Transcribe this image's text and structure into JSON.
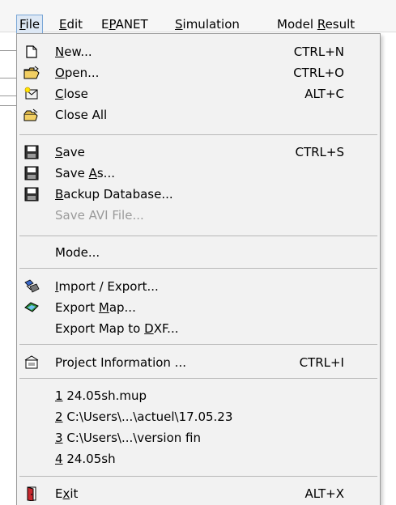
{
  "menubar": {
    "items": [
      {
        "pre": "",
        "u": "F",
        "post": "ile"
      },
      {
        "pre": "",
        "u": "E",
        "post": "dit"
      },
      {
        "pre": "E",
        "u": "P",
        "post": "ANET"
      },
      {
        "pre": "",
        "u": "S",
        "post": "imulation"
      },
      {
        "pre": "Model ",
        "u": "R",
        "post": "esult"
      }
    ]
  },
  "file_menu": {
    "items": [
      {
        "pre": "",
        "u": "N",
        "post": "ew...",
        "shortcut": "CTRL+N",
        "icon": "new-file-icon"
      },
      {
        "pre": "",
        "u": "O",
        "post": "pen...",
        "shortcut": "CTRL+O",
        "icon": "open-folder-icon"
      },
      {
        "pre": "",
        "u": "C",
        "post": "lose",
        "shortcut": "ALT+C",
        "icon": "close-icon"
      },
      {
        "pre": "Close All",
        "u": "",
        "post": "",
        "shortcut": "",
        "icon": "close-all-icon"
      },
      {
        "pre": "",
        "u": "S",
        "post": "ave",
        "shortcut": "CTRL+S",
        "icon": "save-icon"
      },
      {
        "pre": "Save ",
        "u": "A",
        "post": "s...",
        "shortcut": "",
        "icon": "save-as-icon"
      },
      {
        "pre": "",
        "u": "B",
        "post": "ackup Database...",
        "shortcut": "",
        "icon": "backup-database-icon"
      },
      {
        "pre": "Save AVI File...",
        "u": "",
        "post": "",
        "shortcut": ""
      },
      {
        "pre": "Mode...",
        "u": "",
        "post": "",
        "shortcut": ""
      },
      {
        "pre": "",
        "u": "I",
        "post": "mport / Export...",
        "shortcut": "",
        "icon": "import-export-icon"
      },
      {
        "pre": "Export ",
        "u": "M",
        "post": "ap...",
        "shortcut": "",
        "icon": "export-map-icon"
      },
      {
        "pre": "Export Map to ",
        "u": "D",
        "post": "XF...",
        "shortcut": ""
      },
      {
        "pre": "Project Information ...",
        "u": "",
        "post": "",
        "shortcut": "CTRL+I",
        "icon": "project-information-icon"
      },
      {
        "pre": "",
        "u": "1",
        "post": " 24.05sh.mup",
        "shortcut": ""
      },
      {
        "pre": "",
        "u": "2",
        "post": " C:\\Users\\...\\actuel\\17.05.23",
        "shortcut": ""
      },
      {
        "pre": "",
        "u": "3",
        "post": " C:\\Users\\...\\version fin",
        "shortcut": ""
      },
      {
        "pre": "",
        "u": "4",
        "post": " 24.05sh",
        "shortcut": ""
      },
      {
        "pre": "E",
        "u": "x",
        "post": "it",
        "shortcut": "ALT+X",
        "icon": "exit-door-icon"
      }
    ]
  }
}
